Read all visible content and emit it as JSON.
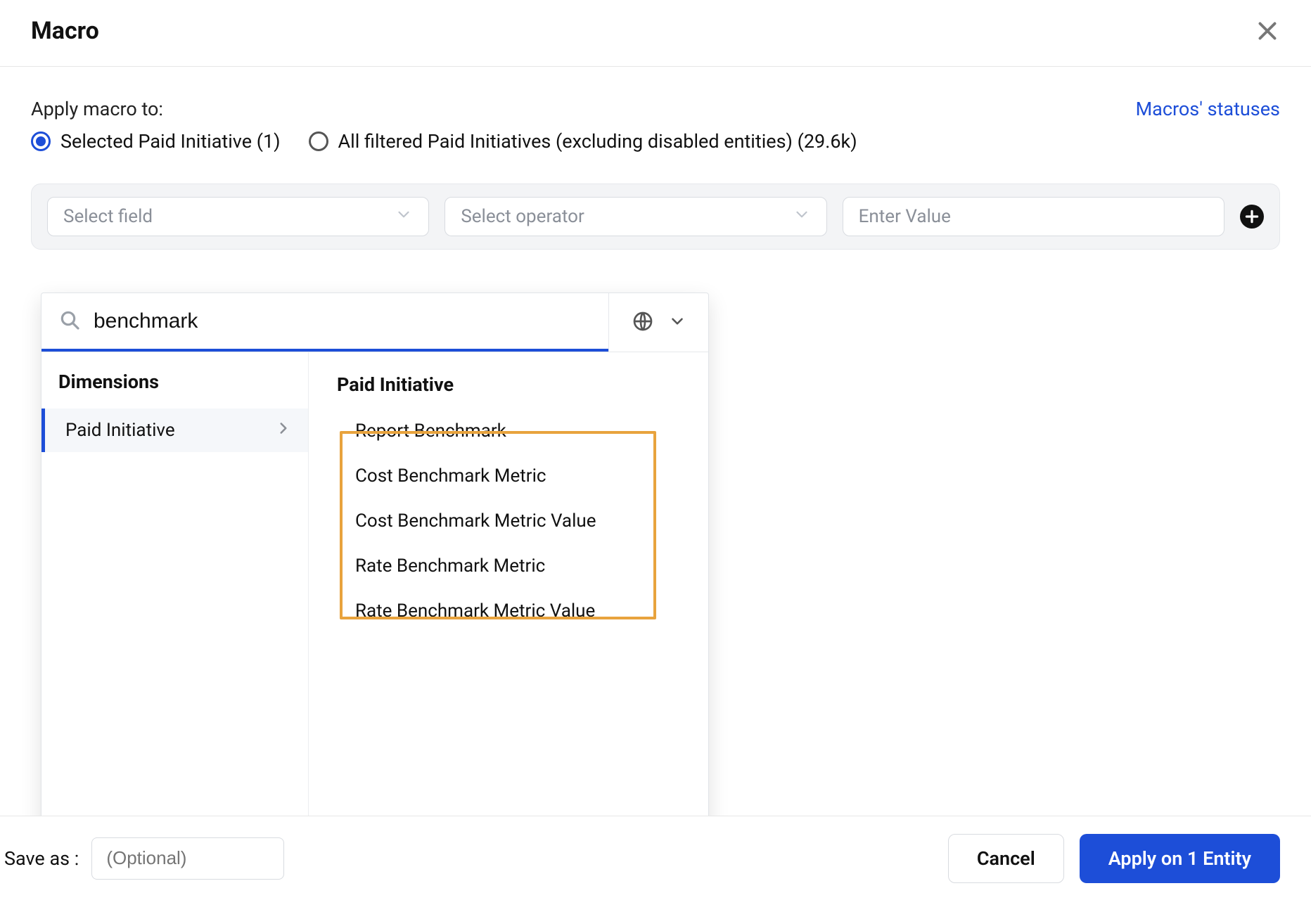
{
  "header": {
    "title": "Macro"
  },
  "apply": {
    "label": "Apply macro to:",
    "statuses_link": "Macros' statuses",
    "options": [
      {
        "label": "Selected Paid Initiative (1)",
        "selected": true
      },
      {
        "label": "All filtered Paid Initiatives (excluding disabled entities) (29.6k)",
        "selected": false
      }
    ]
  },
  "filter": {
    "field_placeholder": "Select field",
    "operator_placeholder": "Select operator",
    "value_placeholder": "Enter Value"
  },
  "dropdown": {
    "search_value": "benchmark",
    "left_section_title": "Dimensions",
    "categories": [
      {
        "label": "Paid Initiative",
        "active": true
      }
    ],
    "right_group_title": "Paid Initiative",
    "options": [
      {
        "label": "Report Benchmark",
        "highlighted": false
      },
      {
        "label": "Cost Benchmark Metric",
        "highlighted": true
      },
      {
        "label": "Cost Benchmark Metric Value",
        "highlighted": true
      },
      {
        "label": "Rate Benchmark Metric",
        "highlighted": true
      },
      {
        "label": "Rate Benchmark Metric Value",
        "highlighted": true
      }
    ]
  },
  "footer": {
    "save_as_label": "Save as :",
    "save_as_placeholder": "(Optional)",
    "cancel_label": "Cancel",
    "apply_label": "Apply on 1 Entity"
  }
}
